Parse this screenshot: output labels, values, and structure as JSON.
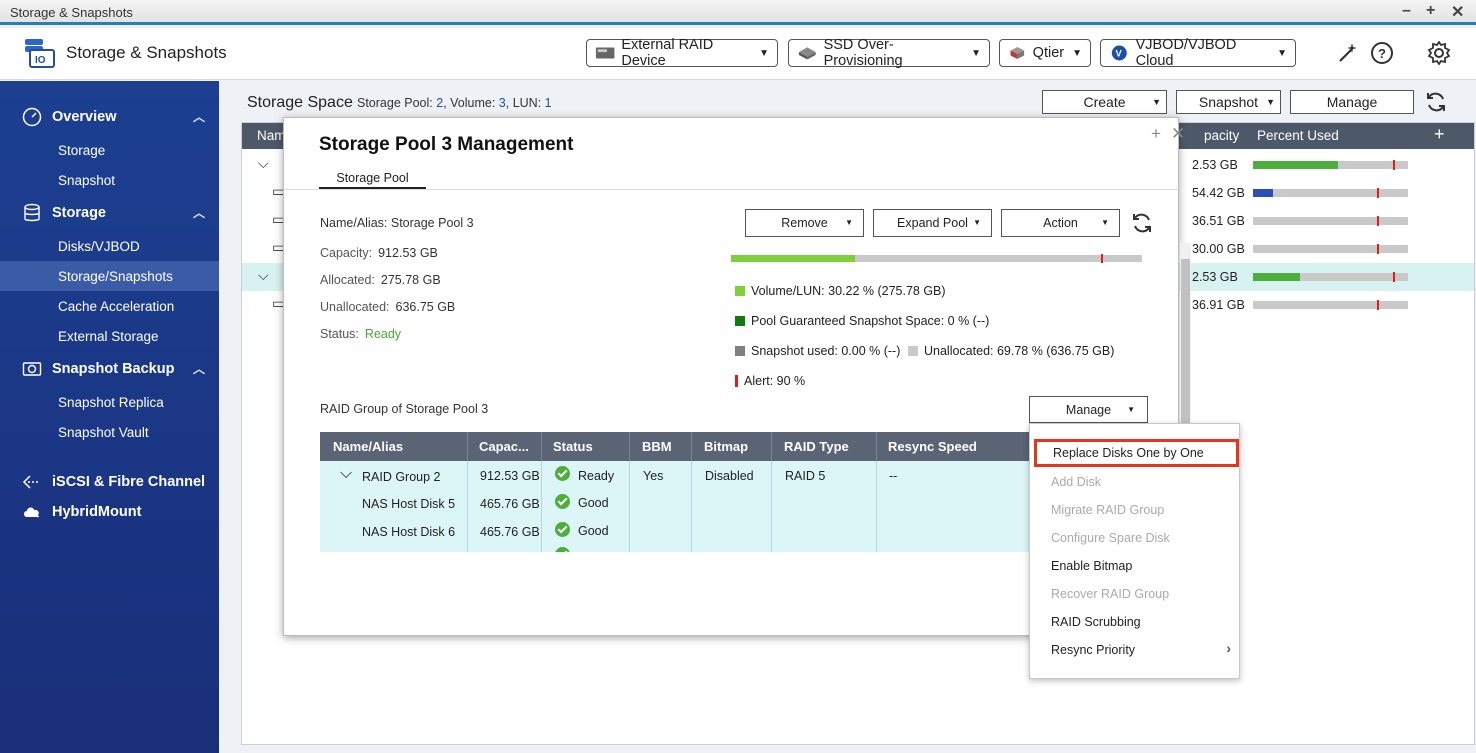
{
  "window": {
    "title": "Storage & Snapshots"
  },
  "header": {
    "app_name": "Storage & Snapshots",
    "buttons": [
      {
        "label": "External RAID Device",
        "icon": "external-raid-icon"
      },
      {
        "label": "SSD Over-Provisioning",
        "icon": "ssd-icon"
      },
      {
        "label": "Qtier",
        "icon": "qtier-icon"
      },
      {
        "label": "VJBOD/VJBOD Cloud",
        "icon": "vjbod-icon"
      }
    ]
  },
  "sidebar": {
    "sections": [
      {
        "label": "Overview",
        "items": [
          "Storage",
          "Snapshot"
        ]
      },
      {
        "label": "Storage",
        "items": [
          "Disks/VJBOD",
          "Storage/Snapshots",
          "Cache Acceleration",
          "External Storage"
        ]
      },
      {
        "label": "Snapshot Backup",
        "items": [
          "Snapshot Replica",
          "Snapshot Vault"
        ]
      },
      {
        "label": "iSCSI & Fibre Channel",
        "items": []
      },
      {
        "label": "HybridMount",
        "items": []
      }
    ],
    "active_item": "Storage/Snapshots"
  },
  "main": {
    "title": "Storage Space",
    "sub_prefix": "Storage Pool:",
    "pool_count": "2",
    "vol_prefix": ", Volume:",
    "volume_count": "3",
    "lun_prefix": ", LUN:",
    "lun_count": "1",
    "buttons": {
      "create": "Create",
      "snapshot": "Snapshot",
      "manage": "Manage"
    },
    "table": {
      "col_name": "Nam",
      "col_capacity": "pacity",
      "col_percent": "Percent Used",
      "rows": [
        {
          "capacity": "2.53 GB",
          "used_pct": 55,
          "alert_pct": 90,
          "color": "#4caf3c"
        },
        {
          "capacity": "54.42 GB",
          "used_pct": 13,
          "alert_pct": 80,
          "color": "#2a4fb5"
        },
        {
          "capacity": "36.51 GB",
          "used_pct": 0,
          "alert_pct": 80,
          "color": "#4caf3c"
        },
        {
          "capacity": "30.00 GB",
          "used_pct": 0,
          "alert_pct": 80,
          "color": "#4caf3c"
        },
        {
          "capacity": "2.53 GB",
          "used_pct": 30,
          "alert_pct": 90,
          "color": "#4caf3c"
        },
        {
          "capacity": "36.91 GB",
          "used_pct": 0,
          "alert_pct": 80,
          "color": "#4caf3c"
        }
      ]
    }
  },
  "dialog": {
    "title": "Storage Pool 3 Management",
    "tab": "Storage Pool",
    "name_label": "Name/Alias: Storage Pool 3",
    "capacity_label": "Capacity:",
    "capacity_value": "912.53 GB",
    "allocated_label": "Allocated:",
    "allocated_value": "275.78 GB",
    "unallocated_label": "Unallocated:",
    "unallocated_value": "636.75 GB",
    "status_label": "Status:",
    "status_value": "Ready",
    "buttons": {
      "remove": "Remove",
      "expand": "Expand Pool",
      "action": "Action"
    },
    "usage_pct": 30.22,
    "alert_pct": 90,
    "legend": {
      "volume": "Volume/LUN: 30.22 % (275.78 GB)",
      "guaranteed": "Pool Guaranteed Snapshot Space: 0 % (--)",
      "snapshot": "Snapshot used: 0.00 % (--)",
      "unallocated": "Unallocated: 69.78 % (636.75 GB)",
      "alert": "Alert: 90 %"
    },
    "colors": {
      "volume": "#7ed03a",
      "guaranteed": "#127a12",
      "snapshot": "#808080",
      "unallocated": "#c9c9c9",
      "alert": "#e21b1b"
    },
    "raid_title": "RAID Group of Storage Pool 3",
    "manage_label": "Manage",
    "raid_table": {
      "headers": [
        "Name/Alias",
        "Capac...",
        "Status",
        "BBM",
        "Bitmap",
        "RAID Type",
        "Resync Speed"
      ],
      "group": {
        "name": "RAID Group 2",
        "capacity": "912.53 GB",
        "status": "Ready",
        "bbm": "Yes",
        "bitmap": "Disabled",
        "raid_type": "RAID 5",
        "resync": "--"
      },
      "disks": [
        {
          "name": "NAS Host Disk 5",
          "capacity": "465.76 GB",
          "status": "Good"
        },
        {
          "name": "NAS Host Disk 6",
          "capacity": "465.76 GB",
          "status": "Good"
        }
      ]
    }
  },
  "menu": {
    "items": [
      {
        "label": "Replace Disks One by One",
        "enabled": true,
        "highlighted": true
      },
      {
        "label": "Add Disk",
        "enabled": false
      },
      {
        "label": "Migrate RAID Group",
        "enabled": false
      },
      {
        "label": "Configure Spare Disk",
        "enabled": false
      },
      {
        "label": "Enable Bitmap",
        "enabled": true
      },
      {
        "label": "Recover RAID Group",
        "enabled": false
      },
      {
        "label": "RAID Scrubbing",
        "enabled": true
      },
      {
        "label": "Resync Priority",
        "enabled": true,
        "submenu": true
      }
    ]
  }
}
